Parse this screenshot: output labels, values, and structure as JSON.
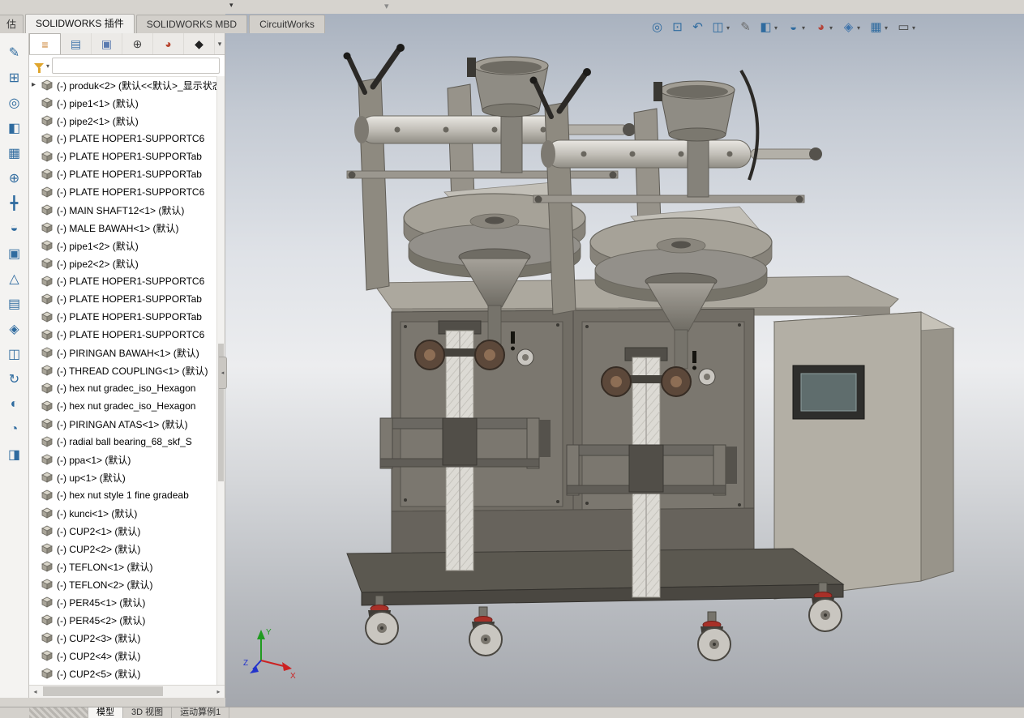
{
  "ui": {
    "caret": "▾",
    "collapse": "◂",
    "h_left": "◂",
    "h_right": "▸"
  },
  "ribbon": {
    "partial_tab": "估",
    "tabs": [
      {
        "label": "SOLIDWORKS 插件",
        "active": true
      },
      {
        "label": "SOLIDWORKS MBD",
        "active": false
      },
      {
        "label": "CircuitWorks",
        "active": false
      }
    ]
  },
  "left_toolbar": {
    "icons": [
      {
        "name": "edit-component-icon",
        "glyph": "✎",
        "color": "#2f6b9f"
      },
      {
        "name": "insert-component-icon",
        "glyph": "⊞",
        "color": "#2f6b9f"
      },
      {
        "name": "mate-icon",
        "glyph": "◎",
        "color": "#2f6b9f"
      },
      {
        "name": "display-style-icon",
        "glyph": "◧",
        "color": "#2f6b9f"
      },
      {
        "name": "linear-pattern-icon",
        "glyph": "▦",
        "color": "#2f6b9f"
      },
      {
        "name": "smart-fastener-icon",
        "glyph": "⊕",
        "color": "#2f6b9f"
      },
      {
        "name": "move-component-icon",
        "glyph": "╋",
        "color": "#2f6b9f"
      },
      {
        "name": "show-hidden-components-icon",
        "glyph": "◒",
        "color": "#2f6b9f"
      },
      {
        "name": "assembly-features-icon",
        "glyph": "▣",
        "color": "#2f6b9f"
      },
      {
        "name": "reference-geometry-icon",
        "glyph": "△",
        "color": "#2f6b9f"
      },
      {
        "name": "bill-of-materials-icon",
        "glyph": "▤",
        "color": "#2f6b9f"
      },
      {
        "name": "exploded-view-icon",
        "glyph": "◈",
        "color": "#2f6b9f"
      },
      {
        "name": "instant-3d-icon",
        "glyph": "◫",
        "color": "#2f6b9f"
      },
      {
        "name": "rebuild-icon",
        "glyph": "↻",
        "color": "#2f6b9f"
      },
      {
        "name": "interference-detection-icon",
        "glyph": "◐",
        "color": "#2f6b9f"
      },
      {
        "name": "measure-icon",
        "glyph": "◔",
        "color": "#2f6b9f"
      },
      {
        "name": "section-icon",
        "glyph": "◨",
        "color": "#2f6b9f"
      }
    ]
  },
  "manager_panel": {
    "tabs": [
      {
        "name": "featuremanager-tab",
        "glyph": "≡",
        "color": "#c87d2a",
        "active": true
      },
      {
        "name": "propertymanager-tab",
        "glyph": "▤",
        "color": "#3f74ab",
        "active": false
      },
      {
        "name": "configurationmanager-tab",
        "glyph": "▣",
        "color": "#5a7ab0",
        "active": false
      },
      {
        "name": "dimxpertmanager-tab",
        "glyph": "⊕",
        "color": "#444444",
        "active": false
      },
      {
        "name": "displaymanager-tab",
        "glyph": "◕",
        "color": "#b8452f",
        "active": false
      },
      {
        "name": "cam-tab",
        "glyph": "◆",
        "color": "#222222",
        "active": false
      }
    ],
    "filter": {
      "value": "",
      "placeholder": ""
    },
    "tree": {
      "expander": "▸",
      "items": [
        {
          "label": "(-) produk<2> (默认<<默认>_显示状态"
        },
        {
          "label": "(-) pipe1<1> (默认)"
        },
        {
          "label": "(-) pipe2<1> (默认)"
        },
        {
          "label": "(-) PLATE HOPER1-SUPPORTC6"
        },
        {
          "label": "(-) PLATE HOPER1-SUPPORTab"
        },
        {
          "label": "(-) PLATE HOPER1-SUPPORTab"
        },
        {
          "label": "(-) PLATE HOPER1-SUPPORTC6"
        },
        {
          "label": "(-) MAIN SHAFT12<1> (默认)"
        },
        {
          "label": "(-) MALE BAWAH<1> (默认)"
        },
        {
          "label": "(-) pipe1<2> (默认)"
        },
        {
          "label": "(-) pipe2<2> (默认)"
        },
        {
          "label": "(-) PLATE HOPER1-SUPPORTC6"
        },
        {
          "label": "(-) PLATE HOPER1-SUPPORTab"
        },
        {
          "label": "(-) PLATE HOPER1-SUPPORTab"
        },
        {
          "label": "(-) PLATE HOPER1-SUPPORTC6"
        },
        {
          "label": "(-) PIRINGAN BAWAH<1> (默认)"
        },
        {
          "label": "(-) THREAD COUPLING<1> (默认)"
        },
        {
          "label": "(-) hex nut gradec_iso_Hexagon"
        },
        {
          "label": "(-) hex nut gradec_iso_Hexagon"
        },
        {
          "label": "(-) PIRINGAN ATAS<1> (默认)"
        },
        {
          "label": "(-) radial ball bearing_68_skf_S"
        },
        {
          "label": "(-) ppa<1> (默认)"
        },
        {
          "label": "(-) up<1> (默认)"
        },
        {
          "label": "(-) hex nut style 1 fine gradeab"
        },
        {
          "label": "(-) kunci<1> (默认)"
        },
        {
          "label": "(-) CUP2<1> (默认)"
        },
        {
          "label": "(-) CUP2<2> (默认)"
        },
        {
          "label": "(-) TEFLON<1> (默认)"
        },
        {
          "label": "(-) TEFLON<2> (默认)"
        },
        {
          "label": "(-) PER45<1> (默认)"
        },
        {
          "label": "(-) PER45<2> (默认)"
        },
        {
          "label": "(-) CUP2<3> (默认)"
        },
        {
          "label": "(-) CUP2<4> (默认)"
        },
        {
          "label": "(-) CUP2<5> (默认)"
        }
      ]
    }
  },
  "headsup": {
    "caret_glyph": "▾",
    "icons": [
      {
        "name": "zoom-to-fit-icon",
        "glyph": "◎",
        "caret": false,
        "color": "#2f6b9f"
      },
      {
        "name": "zoom-to-area-icon",
        "glyph": "⊡",
        "caret": false,
        "color": "#2f6b9f"
      },
      {
        "name": "previous-view-icon",
        "glyph": "↶",
        "caret": false,
        "color": "#2f6b9f"
      },
      {
        "name": "section-view-icon",
        "glyph": "◫",
        "caret": true,
        "color": "#2f6b9f"
      },
      {
        "name": "annotation-icon",
        "glyph": "✎",
        "caret": false,
        "color": "#6b6b6b"
      },
      {
        "name": "display-style-icon",
        "glyph": "◧",
        "caret": true,
        "color": "#2f6b9f"
      },
      {
        "name": "hide-show-items-icon",
        "glyph": "◒",
        "caret": true,
        "color": "#2f6b9f"
      },
      {
        "name": "edit-appearance-icon",
        "glyph": "◕",
        "caret": true,
        "color": "#b5443a"
      },
      {
        "name": "apply-scene-icon",
        "glyph": "◈",
        "caret": true,
        "color": "#3f74ab"
      },
      {
        "name": "view-settings-icon",
        "glyph": "▦",
        "caret": true,
        "color": "#2f6b9f"
      },
      {
        "name": "screen-view-icon",
        "glyph": "▭",
        "caret": true,
        "color": "#444444"
      }
    ]
  },
  "viewport": {
    "triad": {
      "x_label": "X",
      "y_label": "Y",
      "z_label": "Z"
    }
  },
  "status_bar": {
    "tabs": [
      {
        "label": "模型",
        "active": true
      },
      {
        "label": "3D 视图",
        "active": false
      },
      {
        "label": "运动算例1",
        "active": false
      }
    ]
  },
  "palette": {
    "viewport_top": "#a9b2bf",
    "viewport_mid": "#ecedef",
    "viewport_bottom": "#a2a5ab",
    "machine_body": "#aba79d",
    "machine_panel": "#716d65",
    "accent_red": "#a83028",
    "icon_blue": "#2f6b9f"
  }
}
